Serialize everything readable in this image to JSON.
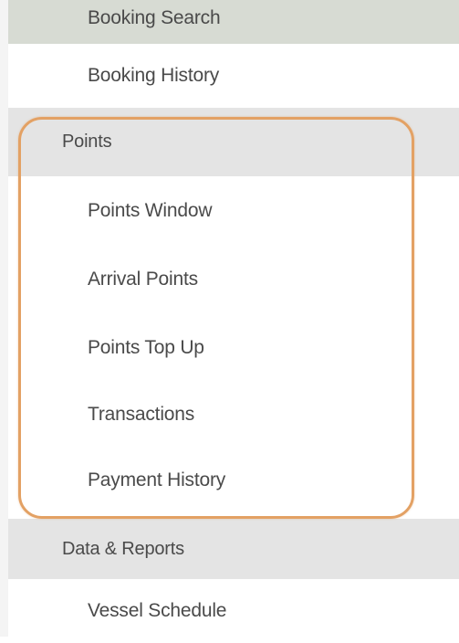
{
  "menu": {
    "top_items": [
      {
        "label": "Booking Search"
      },
      {
        "label": "Booking History"
      }
    ],
    "points_section": {
      "label": "Points",
      "items": [
        {
          "label": "Points Window"
        },
        {
          "label": "Arrival Points"
        },
        {
          "label": "Points Top Up"
        },
        {
          "label": "Transactions"
        },
        {
          "label": "Payment History"
        }
      ]
    },
    "data_section": {
      "label": "Data & Reports",
      "items": [
        {
          "label": "Vessel Schedule"
        }
      ]
    }
  },
  "colors": {
    "highlight_outline": "#e3a164",
    "section_background": "#e4e4e4",
    "active_item_background": "#d7dbd3"
  }
}
